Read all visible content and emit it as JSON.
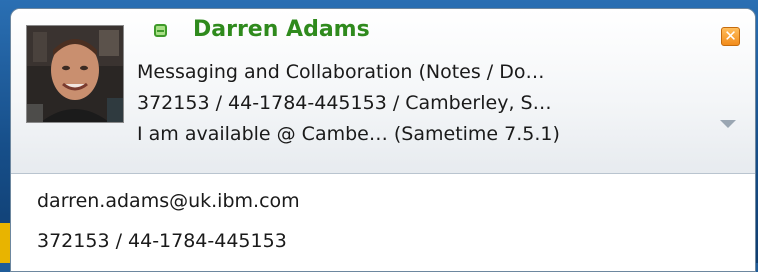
{
  "contact": {
    "name": "Darren Adams",
    "status": "available",
    "status_color": "#3f9a2a",
    "department": "Messaging and Collaboration (Notes / Do…",
    "phone_location": "372153 / 44-1784-445153 / Camberley, S…",
    "status_message": "I am available @ Cambe… (Sametime 7.5.1)"
  },
  "details": {
    "email": "darren.adams@uk.ibm.com",
    "phone": "372153 / 44-1784-445153"
  },
  "icons": {
    "status": "status-available-icon",
    "close": "close-icon",
    "expand": "chevron-down-icon"
  },
  "close_glyph": "✕"
}
